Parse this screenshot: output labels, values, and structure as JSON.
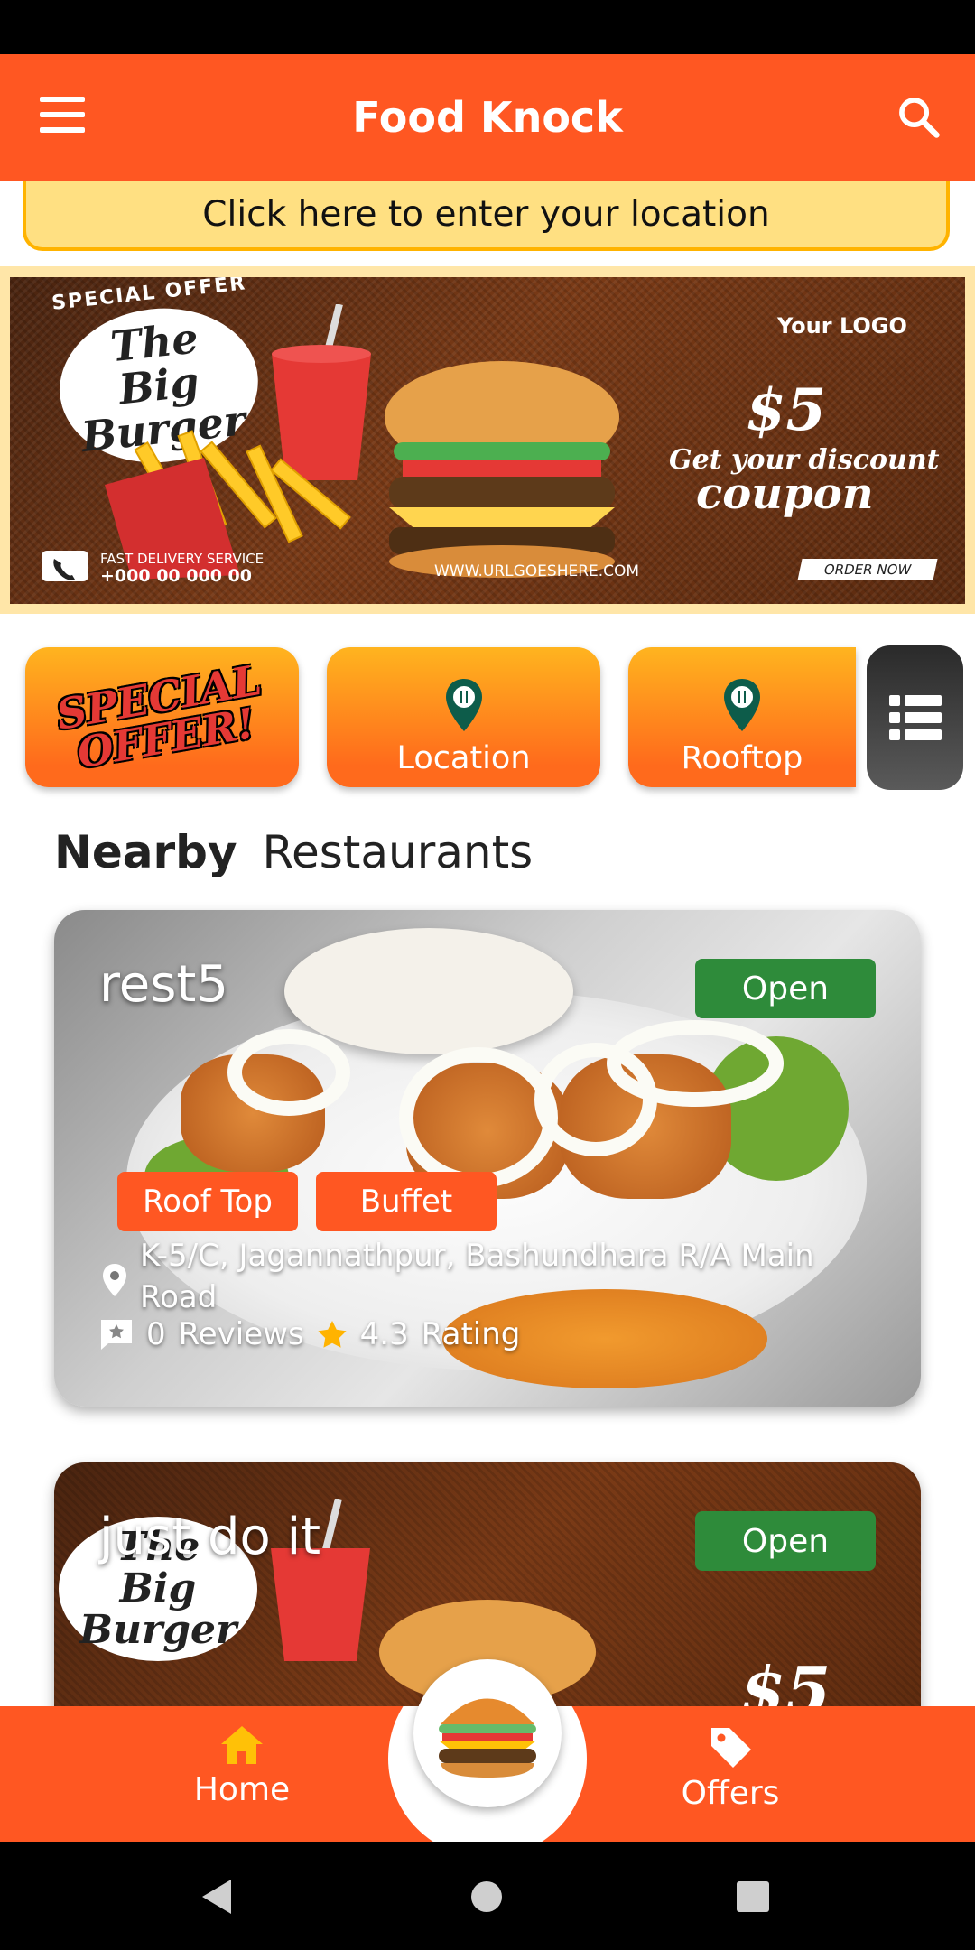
{
  "app": {
    "title": "Food Knock"
  },
  "location": {
    "prompt": "Click here to enter your location"
  },
  "banner": {
    "tagline": "SPECIAL OFFER",
    "headline": "The Big Burger",
    "price": "$5",
    "discount_line": "Get your discount",
    "coupon": "coupon",
    "logo": "Your LOGO",
    "delivery_label": "FAST DELIVERY SERVICE",
    "phone": "+000 00 000 00",
    "url": "WWW.URLGOESHERE.COM",
    "order_button": "ORDER NOW"
  },
  "categories": {
    "special": "SPECIAL OFFER!",
    "location": "Location",
    "rooftop": "Rooftop"
  },
  "section": {
    "bold": "Nearby",
    "rest": "Restaurants"
  },
  "restaurants": [
    {
      "name": "rest5",
      "status": "Open",
      "tags": [
        "Roof Top",
        "Buffet"
      ],
      "address": "K-5/C, Jagannathpur, Bashundhara R/A Main Road",
      "reviews": "0",
      "reviews_label": "Reviews",
      "rating": "4.3",
      "rating_label": "Rating"
    },
    {
      "name": "just do it",
      "status": "Open",
      "banner_headline": "The Big Burger",
      "banner_price": "$5"
    }
  ],
  "bottom_nav": {
    "home": "Home",
    "offers": "Offers"
  },
  "colors": {
    "primary": "#ff5722",
    "location_bg": "#ffe082",
    "open_green": "#2e8b3a",
    "star": "#ffb300"
  },
  "icons": [
    "menu-icon",
    "search-icon",
    "map-pin-icon",
    "list-icon",
    "location-pin-icon",
    "review-icon",
    "star-icon",
    "home-icon",
    "tag-icon",
    "burger-icon",
    "back-icon",
    "home-circle-icon",
    "recents-icon"
  ]
}
